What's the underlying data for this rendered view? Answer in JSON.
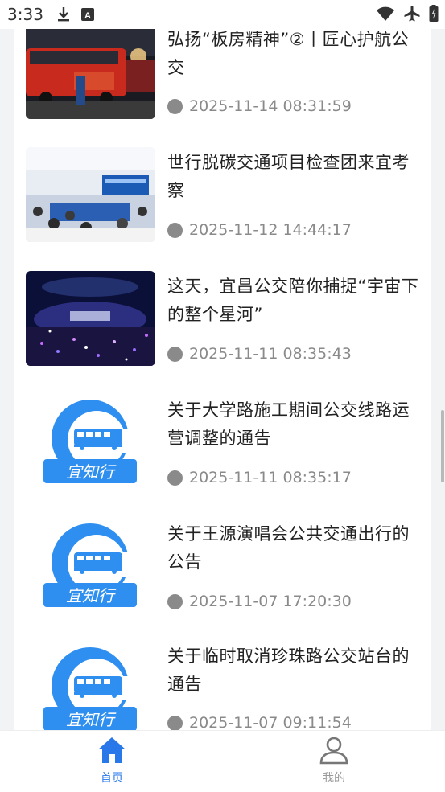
{
  "status_bar": {
    "time": "3:33"
  },
  "news": [
    {
      "title": "弘扬“板房精神”②丨匠心护航公交",
      "date": "2025-11-14 08:31:59",
      "thumb": "photo-bus"
    },
    {
      "title": "世行脱碳交通项目检查团来宜考察",
      "date": "2025-11-12 14:44:17",
      "thumb": "photo-meeting"
    },
    {
      "title": "这天，宜昌公交陪你捕捉“宇宙下的整个星河”",
      "date": "2025-11-11 08:35:43",
      "thumb": "photo-concert"
    },
    {
      "title": "关于大学路施工期间公交线路运营调整的通告",
      "date": "2025-11-11 08:35:17",
      "thumb": "logo"
    },
    {
      "title": "关于王源演唱会公共交通出行的公告",
      "date": "2025-11-07 17:20:30",
      "thumb": "logo"
    },
    {
      "title": "关于临时取消珍珠路公交站台的通告",
      "date": "2025-11-07 09:11:54",
      "thumb": "logo"
    }
  ],
  "logo_text": "宜知行",
  "nav": {
    "home": "首页",
    "mine": "我的"
  },
  "colors": {
    "accent": "#2878ea",
    "muted": "#8a8a8a"
  }
}
